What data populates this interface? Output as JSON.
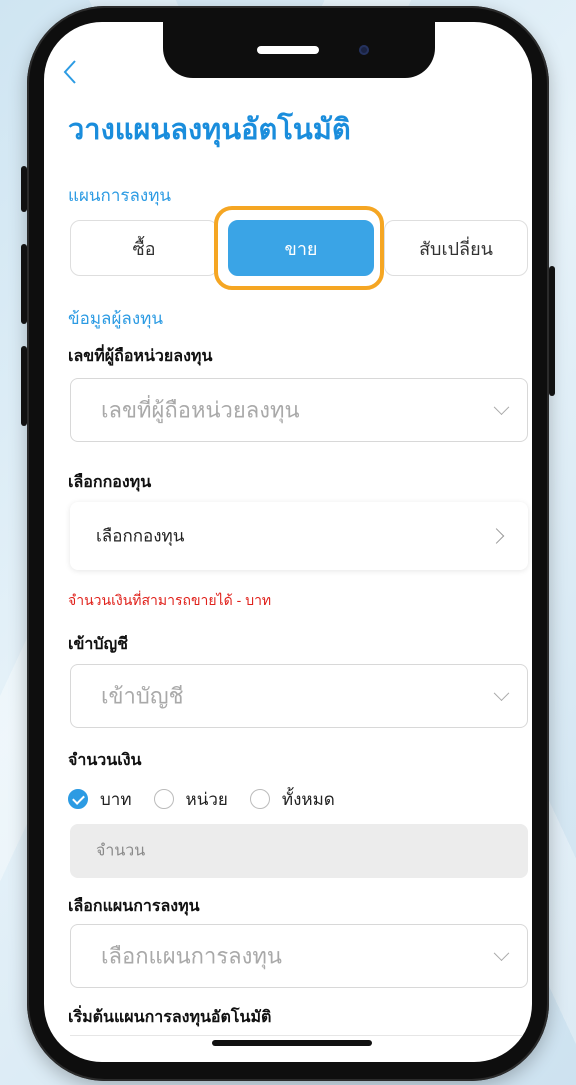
{
  "header": {
    "back_label": "<",
    "title": "วางแผนลงทุนอัตโนมัติ"
  },
  "plan_section": {
    "label": "แผนการลงทุน",
    "options": [
      "ซื้อ",
      "ขาย",
      "สับเปลี่ยน"
    ],
    "selected": "ขาย"
  },
  "investor_section": {
    "label": "ข้อมูลผู้ลงทุน"
  },
  "holder_number": {
    "label": "เลขที่ผู้ถือหน่วยลงทุน",
    "placeholder": "เลขที่ผู้ถือหน่วยลงทุน"
  },
  "fund": {
    "label": "เลือกกองทุน",
    "value": "เลือกกองทุน"
  },
  "sellable_note": "จำนวนเงินที่สามารถขายได้ - บาท",
  "account": {
    "label": "เข้าบัญชี",
    "placeholder": "เข้าบัญชี"
  },
  "amount": {
    "label": "จำนวนเงิน",
    "options": [
      "บาท",
      "หน่วย",
      "ทั้งหมด"
    ],
    "selected": "บาท",
    "placeholder": "จำนวน"
  },
  "investment_plan": {
    "label": "เลือกแผนการลงทุน",
    "placeholder": "เลือกแผนการลงทุน"
  },
  "start_plan": {
    "label": "เริ่มต้นแผนการลงทุนอัตโนมัติ"
  },
  "colors": {
    "accent": "#2c9be3",
    "highlight": "#f5a623",
    "warning": "#e0211b"
  }
}
